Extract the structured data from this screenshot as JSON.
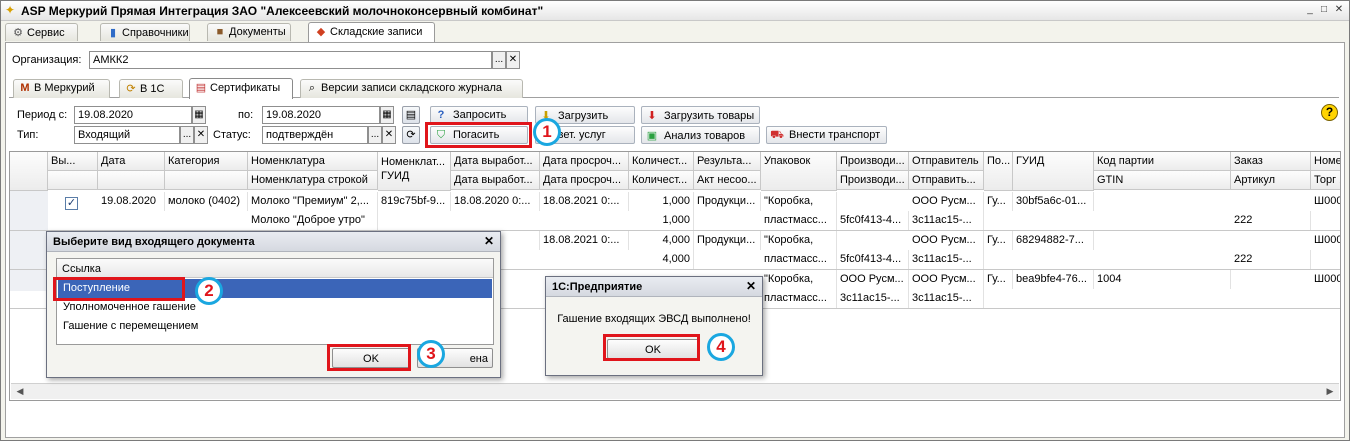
{
  "window": {
    "title": "ASP Меркурий Прямая Интеграция ЗАО \"Алексеевский молочноконсервный комбинат\""
  },
  "main_tabs": [
    {
      "label": "Сервис",
      "icon": "gear-icon"
    },
    {
      "label": "Справочники",
      "icon": "book-icon"
    },
    {
      "label": "Документы",
      "icon": "briefcase-icon"
    },
    {
      "label": "Складские записи",
      "icon": "warehouse-icon"
    }
  ],
  "org": {
    "label": "Организация:",
    "value": "АМКК2"
  },
  "sub_tabs": [
    {
      "label": "В Меркурий",
      "icon": "mercury-icon"
    },
    {
      "label": "В 1С",
      "icon": "exchange-icon"
    },
    {
      "label": "Сертификаты",
      "icon": "document-icon"
    },
    {
      "label": "Версии записи складского журнала",
      "icon": "search-icon"
    }
  ],
  "filters": {
    "period_label": "Период с:",
    "period_from": "19.08.2020",
    "period_to_label": "по:",
    "period_to": "19.08.2020",
    "type_label": "Тип:",
    "type_value": "Входящий",
    "status_label": "Статус:",
    "status_value": "подтверждён"
  },
  "toolbar": {
    "request": "Запросить",
    "load": "Загрузить",
    "load_goods": "Загрузить товары",
    "redeem": "Погасить",
    "vet_services": "ст вет. услуг",
    "analyze_goods": "Анализ товаров",
    "enter_transport": "Внести транспорт"
  },
  "grid": {
    "headers_top": [
      "Вы...",
      "Дата",
      "Категория",
      "Номенклатура",
      "Номенклат... ГУИД",
      "Дата выработ...",
      "Дата просроч...",
      "Количест...",
      "Результа...",
      "Упаковок",
      "Производи...",
      "Отправитель",
      "По...",
      "ГУИД",
      "Код партии",
      "Заказ",
      "Номе"
    ],
    "headers_bottom": [
      "",
      "",
      "",
      "Номенклатура строкой",
      "",
      "Дата выработ...",
      "Дата просроч...",
      "Количест...",
      "Акт несоо...",
      "",
      "Производи...",
      "Отправить...",
      "",
      "",
      "GTIN",
      "Артикул",
      "Торг 1"
    ],
    "rows": [
      {
        "top": [
          "",
          "19.08.2020",
          "молоко (0402)",
          "Молоко \"Премиум\" 2,...",
          "819c75bf-9...",
          "18.08.2020 0:...",
          "18.08.2021 0:...",
          "1,000",
          "Продукци...",
          "\"Коробка,",
          "",
          "ООО Русм...",
          "Гу...",
          "30bf5a6c-01...",
          "",
          "",
          "Ш000"
        ],
        "bottom": [
          "",
          "",
          "",
          "Молоко \"Доброе утро\"",
          "",
          "",
          "",
          "1,000",
          "",
          "пластмасс...",
          "5fc0f413-4...",
          "3c11ac15-...",
          "",
          "",
          "",
          "222",
          ""
        ]
      },
      {
        "top": [
          "",
          "",
          "",
          "",
          "",
          "0 0:...",
          "18.08.2021 0:...",
          "4,000",
          "Продукци...",
          "\"Коробка,",
          "",
          "ООО Русм...",
          "Гу...",
          "68294882-7...",
          "",
          "",
          "Ш000"
        ],
        "bottom": [
          "",
          "",
          "",
          "",
          "",
          "",
          "",
          "4,000",
          "",
          "пластмасс...",
          "5fc0f413-4...",
          "3c11ac15-...",
          "",
          "",
          "",
          "222",
          ""
        ]
      },
      {
        "top": [
          "",
          "",
          "",
          "",
          "",
          "",
          "",
          "",
          "",
          "\"Коробка,",
          "ООО Русм...",
          "ООО Русм...",
          "Гу...",
          "bea9bfe4-76...",
          "1004",
          "",
          "Ш000"
        ],
        "bottom": [
          "",
          "",
          "",
          "",
          "",
          "",
          "",
          "",
          "",
          "пластмасс...",
          "3c11ac15-...",
          "3c11ac15-...",
          "",
          "",
          "",
          "",
          ""
        ]
      }
    ]
  },
  "dialog_doc_type": {
    "title": "Выберите вид входящего документа",
    "column": "Ссылка",
    "items": [
      "Поступление",
      "Уполномоченное гашение",
      "Гашение с перемещением"
    ],
    "ok": "OK",
    "cancel": "ена"
  },
  "dialog_message": {
    "title": "1С:Предприятие",
    "text": "Гашение входящих ЭВСД выполнено!",
    "ok": "OK"
  },
  "badges": [
    "1",
    "2",
    "3",
    "4"
  ],
  "help_label": "?"
}
